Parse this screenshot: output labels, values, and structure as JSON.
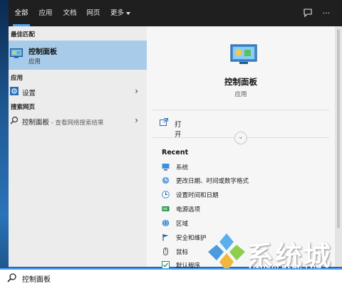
{
  "tabs": [
    {
      "label": "全部"
    },
    {
      "label": "应用"
    },
    {
      "label": "文档"
    },
    {
      "label": "网页"
    },
    {
      "label": "更多"
    }
  ],
  "left": {
    "best_match_title": "最佳匹配",
    "best_match": {
      "title": "控制面板",
      "subtitle": "应用"
    },
    "apps_title": "应用",
    "settings_label": "设置",
    "web_title": "搜索网页",
    "web_query": "控制面板",
    "web_suffix": " - 查看网络搜索结果"
  },
  "preview": {
    "title": "控制面板",
    "subtitle": "应用",
    "open_label": "打开",
    "recent_title": "Recent",
    "recent_items": [
      {
        "label": "系统",
        "icon": "monitor-icon"
      },
      {
        "label": "更改日期、时间或数字格式",
        "icon": "globe-clock-icon"
      },
      {
        "label": "设置时间和日期",
        "icon": "clock-icon"
      },
      {
        "label": "电源选项",
        "icon": "battery-icon"
      },
      {
        "label": "区域",
        "icon": "globe-icon"
      },
      {
        "label": "安全和维护",
        "icon": "flag-icon"
      },
      {
        "label": "鼠标",
        "icon": "mouse-icon"
      },
      {
        "label": "默认程序",
        "icon": "default-programs-icon"
      }
    ]
  },
  "search": {
    "value": "控制面板"
  },
  "watermark": {
    "title": "系统城",
    "url": "XITONGCHENG.COM"
  },
  "colors": {
    "accent": "#4aa3ff",
    "selected": "#a8cbea",
    "topbar": "#1f1f1f"
  }
}
